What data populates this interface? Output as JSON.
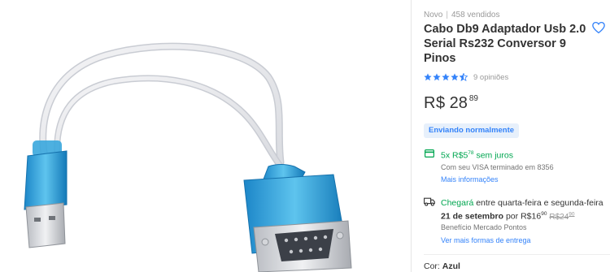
{
  "product": {
    "condition": "Novo",
    "sold_count": "458 vendidos",
    "title": "Cabo Db9 Adaptador Usb 2.0 Serial Rs232 Conversor 9 Pinos",
    "rating": {
      "value": 4.5,
      "max": 5,
      "reviews_label": "9 opiniões"
    },
    "price": {
      "currency": "R$",
      "integer": "28",
      "cents": "89"
    },
    "stock_badge": "Enviando normalmente",
    "installments": {
      "count_prefix": "5x",
      "currency": "R$",
      "amount_int": "5",
      "amount_cents": "78",
      "suffix": "sem juros"
    },
    "card_info": "Com seu VISA terminado em 8356",
    "more_info_link": "Mais informações",
    "shipping": {
      "prefix": "Chegará",
      "range": "entre quarta-feira e segunda-feira",
      "date": "21 de setembro",
      "por": "por",
      "price_currency": "R$",
      "price_int": "16",
      "price_cents": "90",
      "old_currency": "R$",
      "old_int": "24",
      "old_cents": "90",
      "benefit": "Benefício Mercado Pontos",
      "more_link": "Ver mais formas de entrega"
    },
    "variation": {
      "label": "Cor:",
      "value": "Azul"
    }
  },
  "colors": {
    "link_blue": "#3483fa",
    "green": "#00a650",
    "badge_bg": "#e7f0fb",
    "muted": "#999999"
  },
  "icons": {
    "favorite": "heart-icon",
    "installments": "credit-card-icon",
    "shipping": "truck-icon",
    "rating": "star-icon"
  }
}
